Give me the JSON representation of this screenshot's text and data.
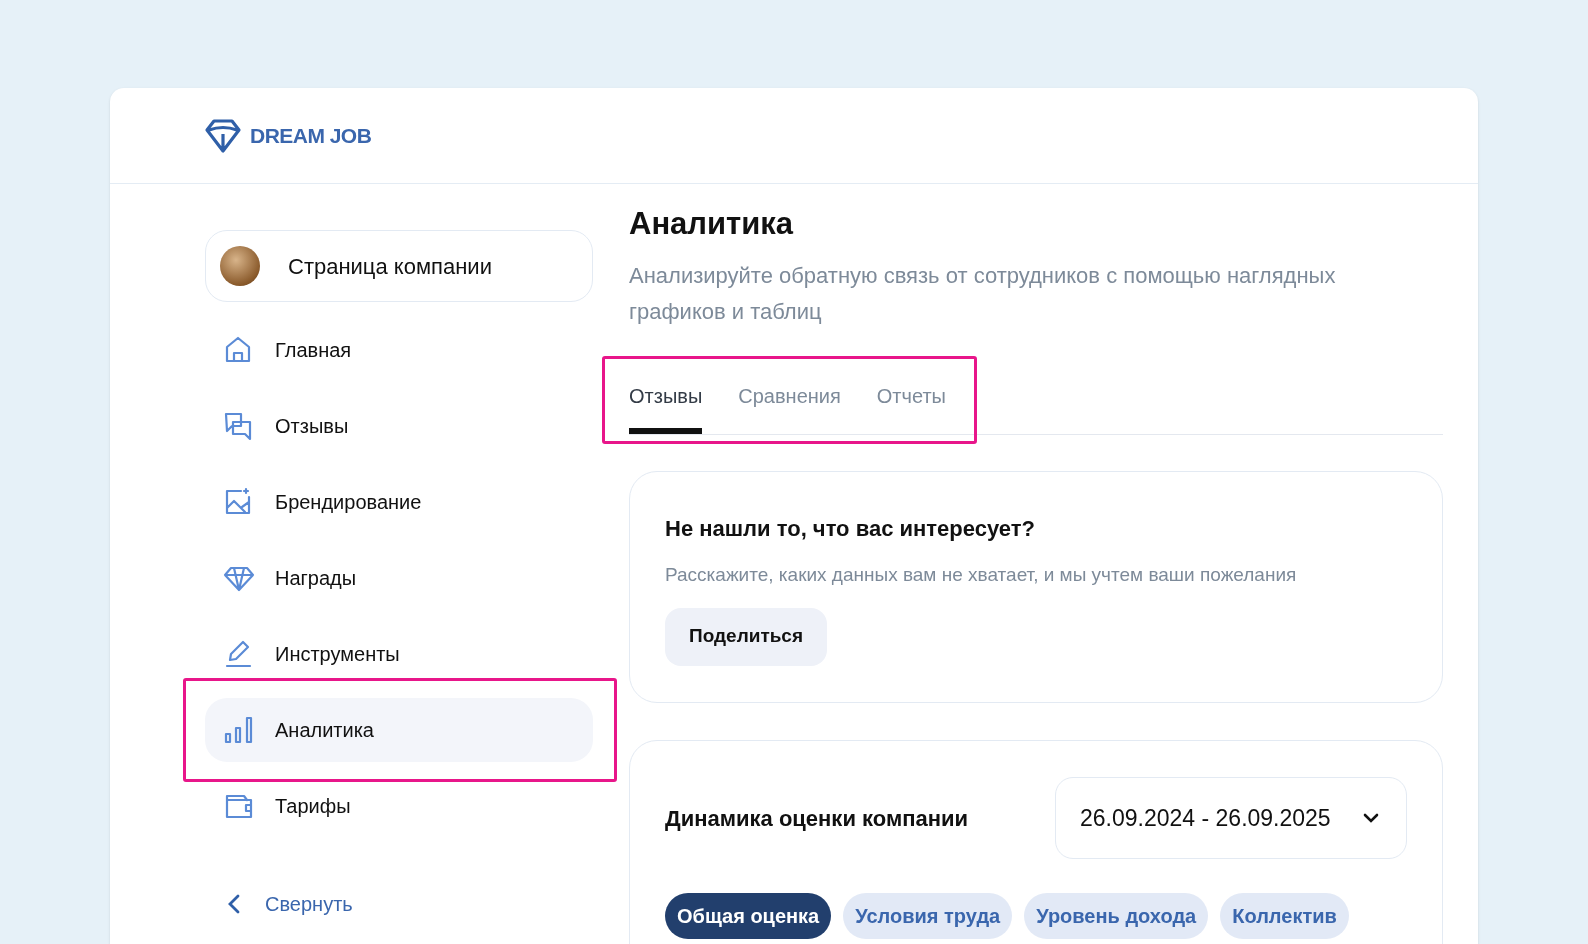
{
  "logo": {
    "text": "DREAM JOB"
  },
  "company": {
    "label": "Страница компании"
  },
  "nav": {
    "highlighted": true,
    "items": [
      {
        "label": "Главная",
        "selected": false
      },
      {
        "label": "Отзывы",
        "selected": false
      },
      {
        "label": "Брендирование",
        "selected": false
      },
      {
        "label": "Награды",
        "selected": false
      },
      {
        "label": "Инструменты",
        "selected": false
      },
      {
        "label": "Аналитика",
        "selected": true
      },
      {
        "label": "Тарифы",
        "selected": false
      }
    ]
  },
  "collapse": {
    "label": "Свернуть"
  },
  "page": {
    "title": "Аналитика",
    "subtitle": "Анализируйте обратную связь от сотрудников с помощью наглядных графиков и таблиц"
  },
  "tabs": {
    "highlighted": true,
    "items": [
      {
        "label": "Отзывы",
        "selected": true
      },
      {
        "label": "Сравнения",
        "selected": false
      },
      {
        "label": "Отчеты",
        "selected": false
      }
    ]
  },
  "feedback_card": {
    "title": "Не нашли то, что вас интересует?",
    "text": "Расскажите, каких данных вам не хватает, и мы учтем ваши пожелания",
    "button": "Поделиться"
  },
  "rating_card": {
    "title": "Динамика оценки компании",
    "date_range": "26.09.2024 - 26.09.2025",
    "chips": [
      {
        "label": "Общая оценка",
        "selected": true
      },
      {
        "label": "Условия труда",
        "selected": false
      },
      {
        "label": "Уровень дохода",
        "selected": false
      },
      {
        "label": "Коллектив",
        "selected": false
      }
    ]
  }
}
